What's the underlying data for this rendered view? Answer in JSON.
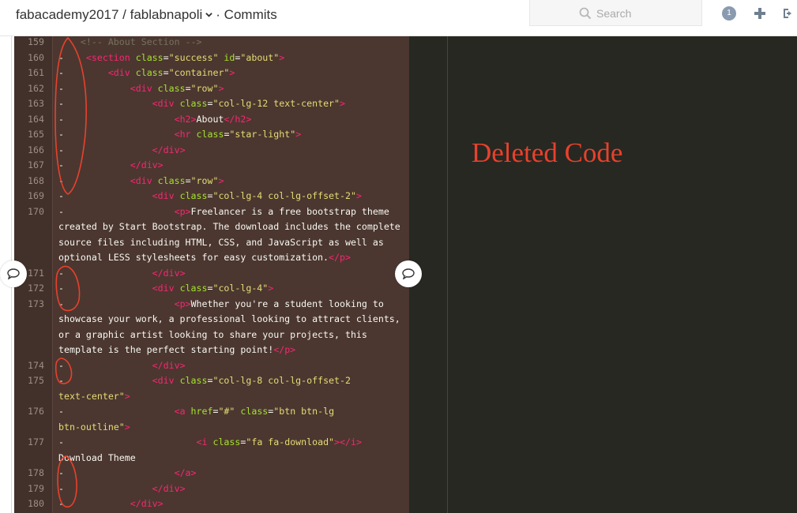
{
  "header": {
    "repo": "fabacademy2017 / fablabnapoli",
    "section": "· Commits",
    "search_placeholder": "Search",
    "notification_count": "1"
  },
  "annotation": {
    "label": "Deleted Code",
    "color": "#e8412c"
  },
  "theme": {
    "code_bg": "#4b3730",
    "right_bg": "#272822",
    "tag_color": "#f92672",
    "attr_color": "#a6e22e",
    "string_color": "#e6db74",
    "text_color": "#f8f8f2",
    "comment_color": "#75715e"
  },
  "code_lines": [
    {
      "num": "159",
      "marker": "",
      "indent": "    ",
      "tokens": [
        {
          "k": "c",
          "v": "<!-- About Section -->"
        }
      ]
    },
    {
      "num": "160",
      "marker": "-",
      "indent": "    ",
      "tokens": [
        {
          "k": "t",
          "v": "<section"
        },
        {
          "k": "a",
          "v": " class"
        },
        {
          "k": "p",
          "v": "="
        },
        {
          "k": "s",
          "v": "\"success\""
        },
        {
          "k": "a",
          "v": " id"
        },
        {
          "k": "p",
          "v": "="
        },
        {
          "k": "s",
          "v": "\"about\""
        },
        {
          "k": "t",
          "v": ">"
        }
      ]
    },
    {
      "num": "161",
      "marker": "-",
      "indent": "        ",
      "tokens": [
        {
          "k": "t",
          "v": "<div"
        },
        {
          "k": "a",
          "v": " class"
        },
        {
          "k": "p",
          "v": "="
        },
        {
          "k": "s",
          "v": "\"container\""
        },
        {
          "k": "t",
          "v": ">"
        }
      ]
    },
    {
      "num": "162",
      "marker": "-",
      "indent": "            ",
      "tokens": [
        {
          "k": "t",
          "v": "<div"
        },
        {
          "k": "a",
          "v": " class"
        },
        {
          "k": "p",
          "v": "="
        },
        {
          "k": "s",
          "v": "\"row\""
        },
        {
          "k": "t",
          "v": ">"
        }
      ]
    },
    {
      "num": "163",
      "marker": "-",
      "indent": "                ",
      "tokens": [
        {
          "k": "t",
          "v": "<div"
        },
        {
          "k": "a",
          "v": " class"
        },
        {
          "k": "p",
          "v": "="
        },
        {
          "k": "s",
          "v": "\"col-lg-12 text-center\""
        },
        {
          "k": "t",
          "v": ">"
        }
      ]
    },
    {
      "num": "164",
      "marker": "-",
      "indent": "                    ",
      "tokens": [
        {
          "k": "t",
          "v": "<h2>"
        },
        {
          "k": "p",
          "v": "About"
        },
        {
          "k": "t",
          "v": "</h2>"
        }
      ]
    },
    {
      "num": "165",
      "marker": "-",
      "indent": "                    ",
      "tokens": [
        {
          "k": "t",
          "v": "<hr"
        },
        {
          "k": "a",
          "v": " class"
        },
        {
          "k": "p",
          "v": "="
        },
        {
          "k": "s",
          "v": "\"star-light\""
        },
        {
          "k": "t",
          "v": ">"
        }
      ]
    },
    {
      "num": "166",
      "marker": "-",
      "indent": "                ",
      "tokens": [
        {
          "k": "t",
          "v": "</div>"
        }
      ]
    },
    {
      "num": "167",
      "marker": "-",
      "indent": "            ",
      "tokens": [
        {
          "k": "t",
          "v": "</div>"
        }
      ]
    },
    {
      "num": "168",
      "marker": "-",
      "indent": "            ",
      "tokens": [
        {
          "k": "t",
          "v": "<div"
        },
        {
          "k": "a",
          "v": " class"
        },
        {
          "k": "p",
          "v": "="
        },
        {
          "k": "s",
          "v": "\"row\""
        },
        {
          "k": "t",
          "v": ">"
        }
      ]
    },
    {
      "num": "169",
      "marker": "-",
      "indent": "                ",
      "tokens": [
        {
          "k": "t",
          "v": "<div"
        },
        {
          "k": "a",
          "v": " class"
        },
        {
          "k": "p",
          "v": "="
        },
        {
          "k": "s",
          "v": "\"col-lg-4 col-lg-offset-2\""
        },
        {
          "k": "t",
          "v": ">"
        }
      ]
    },
    {
      "num": "170",
      "marker": "-",
      "indent": "                    ",
      "tokens": [
        {
          "k": "t",
          "v": "<p>"
        },
        {
          "k": "p",
          "v": "Freelancer is a free bootstrap theme"
        }
      ]
    },
    {
      "num": "",
      "marker": "",
      "indent": "",
      "tokens": [
        {
          "k": "p",
          "v": "created by Start Bootstrap. The download includes the complete"
        }
      ]
    },
    {
      "num": "",
      "marker": "",
      "indent": "",
      "tokens": [
        {
          "k": "p",
          "v": "source files including HTML, CSS, and JavaScript as well as"
        }
      ]
    },
    {
      "num": "",
      "marker": "",
      "indent": "",
      "tokens": [
        {
          "k": "p",
          "v": "optional LESS stylesheets for easy customization."
        },
        {
          "k": "t",
          "v": "</p>"
        }
      ]
    },
    {
      "num": "171",
      "marker": "-",
      "indent": "                ",
      "tokens": [
        {
          "k": "t",
          "v": "</div>"
        }
      ]
    },
    {
      "num": "172",
      "marker": "-",
      "indent": "                ",
      "tokens": [
        {
          "k": "t",
          "v": "<div"
        },
        {
          "k": "a",
          "v": " class"
        },
        {
          "k": "p",
          "v": "="
        },
        {
          "k": "s",
          "v": "\"col-lg-4\""
        },
        {
          "k": "t",
          "v": ">"
        }
      ]
    },
    {
      "num": "173",
      "marker": "-",
      "indent": "                    ",
      "tokens": [
        {
          "k": "t",
          "v": "<p>"
        },
        {
          "k": "p",
          "v": "Whether you're a student looking to"
        }
      ]
    },
    {
      "num": "",
      "marker": "",
      "indent": "",
      "tokens": [
        {
          "k": "p",
          "v": "showcase your work, a professional looking to attract clients,"
        }
      ]
    },
    {
      "num": "",
      "marker": "",
      "indent": "",
      "tokens": [
        {
          "k": "p",
          "v": "or a graphic artist looking to share your projects, this"
        }
      ]
    },
    {
      "num": "",
      "marker": "",
      "indent": "",
      "tokens": [
        {
          "k": "p",
          "v": "template is the perfect starting point!"
        },
        {
          "k": "t",
          "v": "</p>"
        }
      ]
    },
    {
      "num": "174",
      "marker": "-",
      "indent": "                ",
      "tokens": [
        {
          "k": "t",
          "v": "</div>"
        }
      ]
    },
    {
      "num": "175",
      "marker": "-",
      "indent": "                ",
      "tokens": [
        {
          "k": "t",
          "v": "<div"
        },
        {
          "k": "a",
          "v": " class"
        },
        {
          "k": "p",
          "v": "="
        },
        {
          "k": "s",
          "v": "\"col-lg-8 col-lg-offset-2"
        }
      ]
    },
    {
      "num": "",
      "marker": "",
      "indent": "",
      "tokens": [
        {
          "k": "s",
          "v": "text-center\""
        },
        {
          "k": "t",
          "v": ">"
        }
      ]
    },
    {
      "num": "176",
      "marker": "-",
      "indent": "                    ",
      "tokens": [
        {
          "k": "t",
          "v": "<a"
        },
        {
          "k": "a",
          "v": " href"
        },
        {
          "k": "p",
          "v": "="
        },
        {
          "k": "s",
          "v": "\"#\""
        },
        {
          "k": "a",
          "v": " class"
        },
        {
          "k": "p",
          "v": "="
        },
        {
          "k": "s",
          "v": "\"btn btn-lg"
        }
      ]
    },
    {
      "num": "",
      "marker": "",
      "indent": "",
      "tokens": [
        {
          "k": "s",
          "v": "btn-outline\""
        },
        {
          "k": "t",
          "v": ">"
        }
      ]
    },
    {
      "num": "177",
      "marker": "-",
      "indent": "                        ",
      "tokens": [
        {
          "k": "t",
          "v": "<i"
        },
        {
          "k": "a",
          "v": " class"
        },
        {
          "k": "p",
          "v": "="
        },
        {
          "k": "s",
          "v": "\"fa fa-download\""
        },
        {
          "k": "t",
          "v": "></i>"
        }
      ]
    },
    {
      "num": "",
      "marker": "",
      "indent": "",
      "tokens": [
        {
          "k": "p",
          "v": "Download Theme"
        }
      ]
    },
    {
      "num": "178",
      "marker": "-",
      "indent": "                    ",
      "tokens": [
        {
          "k": "t",
          "v": "</a>"
        }
      ]
    },
    {
      "num": "179",
      "marker": "-",
      "indent": "                ",
      "tokens": [
        {
          "k": "t",
          "v": "</div>"
        }
      ]
    },
    {
      "num": "180",
      "marker": "-",
      "indent": "            ",
      "tokens": [
        {
          "k": "t",
          "v": "</div>"
        }
      ]
    }
  ]
}
